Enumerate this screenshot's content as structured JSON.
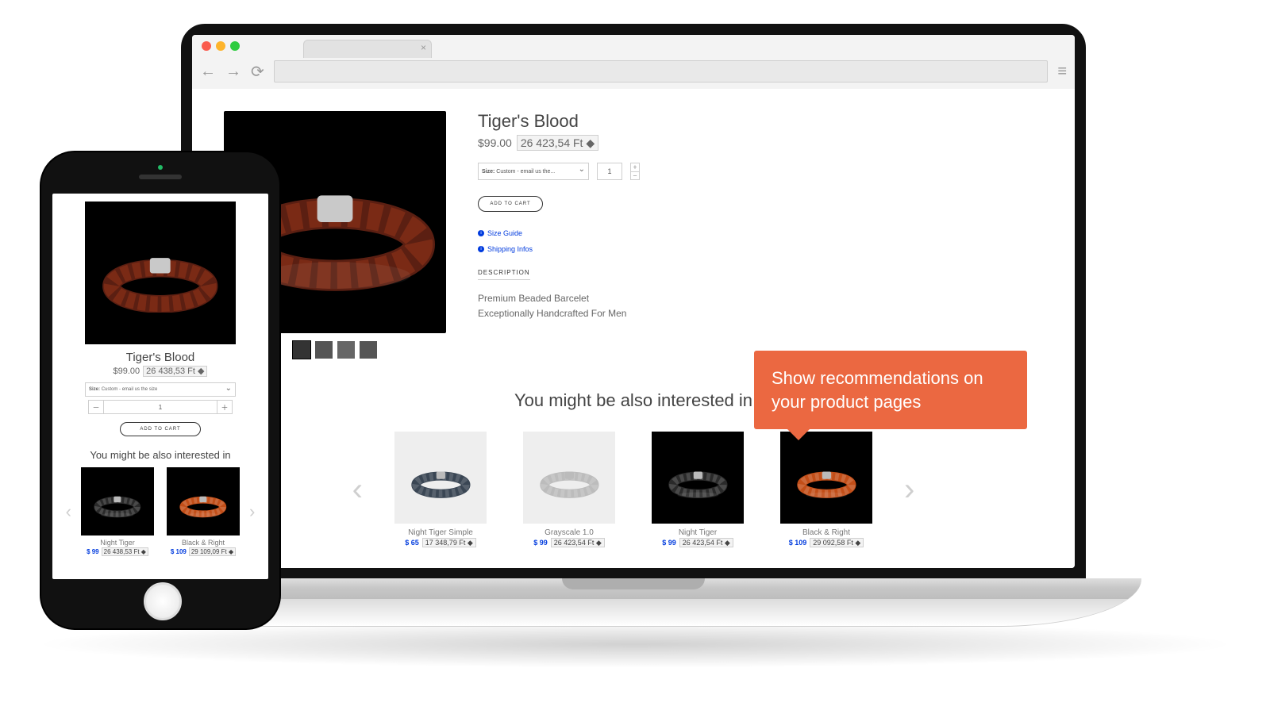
{
  "colors": {
    "accent": "#003bde",
    "callout": "#eb6841"
  },
  "browser": {
    "dots": [
      "#fa5b4d",
      "#fdb42c",
      "#2ecc40"
    ],
    "tab_close": "×"
  },
  "product": {
    "title": "Tiger's Blood",
    "price_usd": "$99.00",
    "price_alt": "26 423,54 Ft",
    "size_label": "Size:",
    "size_value": "Custom - email us the...",
    "qty": "1",
    "add_to_cart": "ADD TO CART",
    "links": {
      "size_guide": "Size Guide",
      "shipping": "Shipping Infos"
    },
    "section": "DESCRIPTION",
    "desc_line1": "Premium Beaded Barcelet",
    "desc_line2": "Exceptionally Handcrafted For Men"
  },
  "mobile_product": {
    "title": "Tiger's Blood",
    "price_usd": "$99.00",
    "price_alt": "26 438,53 Ft",
    "size_label": "Size:",
    "size_value": "Custom - email us the size",
    "qty": "1",
    "add_to_cart": "ADD TO CART"
  },
  "recs_title": "You might be also interested in",
  "recs_desktop": [
    {
      "name": "Night Tiger Simple",
      "usd": "$ 65",
      "alt": "17 348,79 Ft",
      "dark": false,
      "bead": "#3a4654"
    },
    {
      "name": "Grayscale 1.0",
      "usd": "$ 99",
      "alt": "26 423,54 Ft",
      "dark": false,
      "bead": "#bcbcbc"
    },
    {
      "name": "Night Tiger",
      "usd": "$ 99",
      "alt": "26 423,54 Ft",
      "dark": true,
      "bead": "#2a2a2a"
    },
    {
      "name": "Black & Right",
      "usd": "$ 109",
      "alt": "29 092,58 Ft",
      "dark": true,
      "bead": "#c24e18"
    }
  ],
  "recs_mobile": [
    {
      "name": "Night Tiger",
      "usd": "$ 99",
      "alt": "26 438,53 Ft",
      "bead": "#2a2a2a"
    },
    {
      "name": "Black & Right",
      "usd": "$ 109",
      "alt": "29 109,09 Ft",
      "bead": "#c24e18"
    }
  ],
  "callout": "Show recommendations on your product pages"
}
